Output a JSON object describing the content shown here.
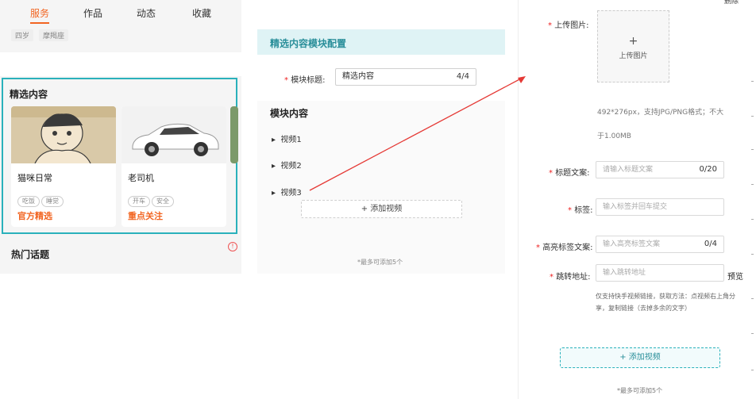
{
  "preview": {
    "tags": [
      "四岁",
      "摩羯座"
    ],
    "tabs": [
      "服务",
      "作品",
      "动态",
      "收藏"
    ],
    "featured_title": "精选内容",
    "cards": [
      {
        "name": "猫咪日常",
        "chips": [
          "吃饭",
          "睡觉"
        ],
        "label": "官方精选"
      },
      {
        "name": "老司机",
        "chips": [
          "开车",
          "安全"
        ],
        "label": "重点关注"
      }
    ],
    "hot_title": "热门话题",
    "warning_symbol": "!"
  },
  "config": {
    "header": "精选内容模块配置",
    "module_title_label": "模块标题:",
    "module_title_value": "精选内容",
    "module_title_count": "4/4",
    "section_title": "模块内容",
    "videos": [
      "视频1",
      "视频2",
      "视频3"
    ],
    "add_video": "+ 添加视频",
    "note": "*最多可添加5个"
  },
  "form": {
    "top_cut_label": "删除",
    "upload_label": "上传图片:",
    "upload_plus": "+",
    "upload_text": "上传图片",
    "upload_hint_line1": "492*276px，支持JPG/PNG格式；不大",
    "upload_hint_line2": "于1.00MB",
    "title_label": "标题文案:",
    "title_placeholder": "请输入标题文案",
    "title_count": "0/20",
    "tag_label": "标签:",
    "tag_placeholder": "输入标签并回车提交",
    "highlight_label": "高亮标签文案:",
    "highlight_placeholder": "输入高亮标签文案",
    "highlight_count": "0/4",
    "link_label": "跳转地址:",
    "link_placeholder": "输入跳转地址",
    "preview": "预览",
    "link_hint": "仅支持快手视频链接，获取方法：点视频右上角分享，复制链接（去掉多余的文字）",
    "add_video": "+ 添加视频",
    "note": "*最多可添加5个",
    "required_mark": "*"
  },
  "colors": {
    "accent_orange": "#f26522",
    "accent_teal": "#2ab1bb",
    "arrow_red": "#e53935"
  }
}
